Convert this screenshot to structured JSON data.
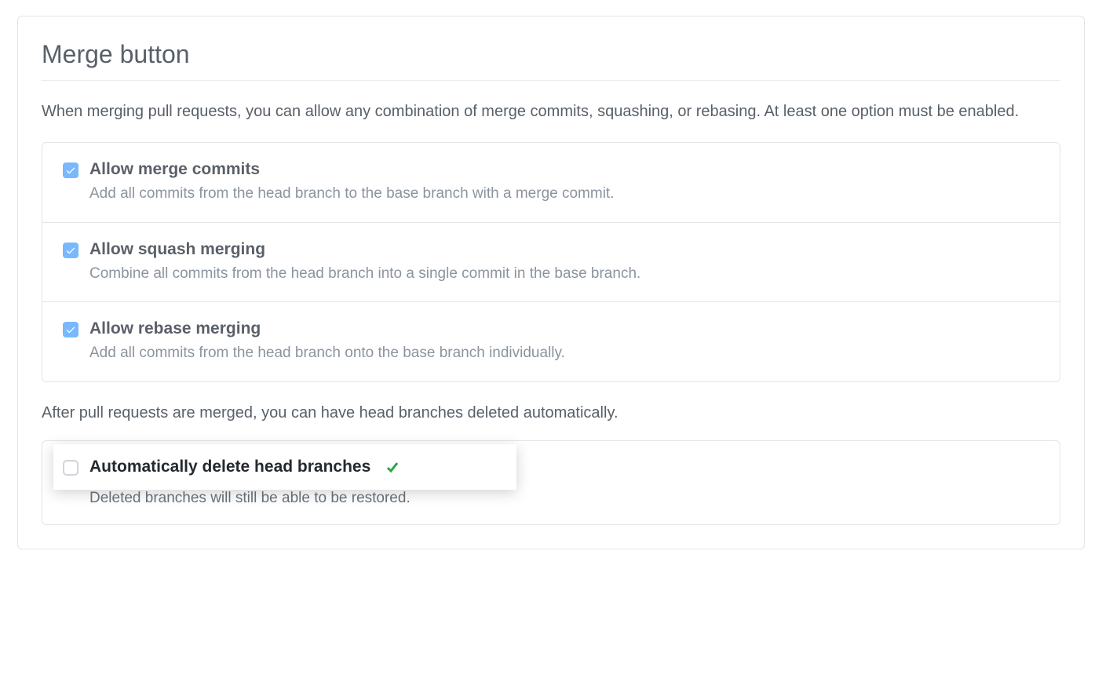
{
  "section": {
    "title": "Merge button",
    "intro": "When merging pull requests, you can allow any combination of merge commits, squashing, or rebasing. At least one option must be enabled.",
    "after_text": "After pull requests are merged, you can have head branches deleted automatically."
  },
  "options": [
    {
      "label": "Allow merge commits",
      "description": "Add all commits from the head branch to the base branch with a merge commit.",
      "checked": true
    },
    {
      "label": "Allow squash merging",
      "description": "Combine all commits from the head branch into a single commit in the base branch.",
      "checked": true
    },
    {
      "label": "Allow rebase merging",
      "description": "Add all commits from the head branch onto the base branch individually.",
      "checked": true
    }
  ],
  "auto_delete": {
    "label": "Automatically delete head branches",
    "description": "Deleted branches will still be able to be restored.",
    "checked": false
  }
}
